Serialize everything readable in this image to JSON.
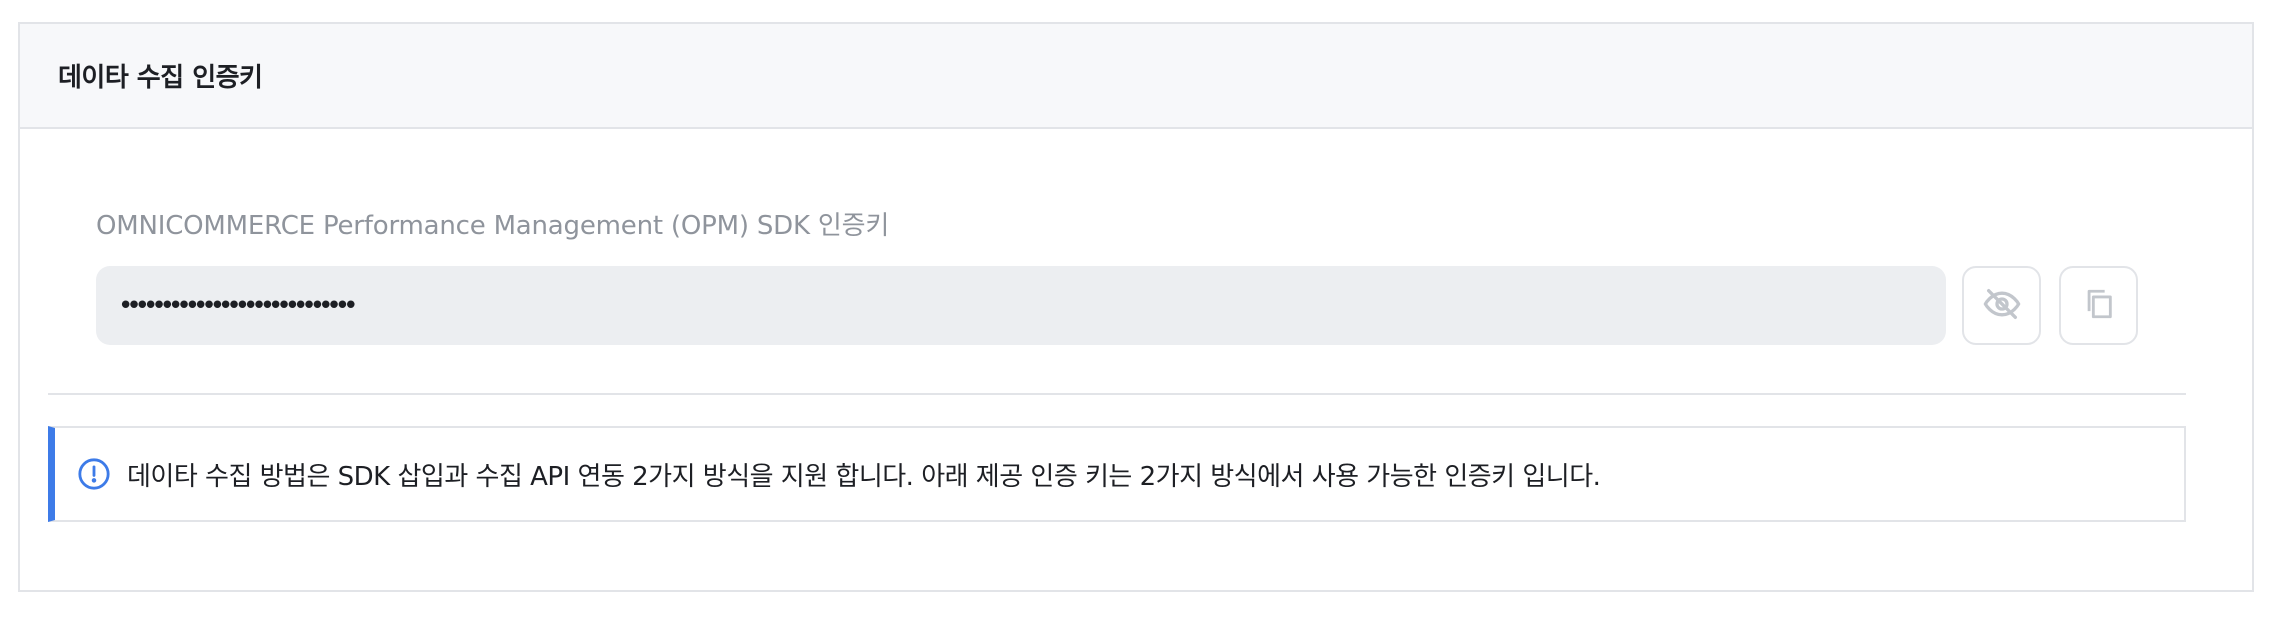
{
  "card": {
    "title": "데이타 수집 인증키"
  },
  "key_field": {
    "label": "OMNICOMMERCE Performance Management (OPM) SDK 인증키",
    "masked_value": "••••••••••••••••••••••••••••",
    "actions": {
      "toggle_visibility_icon": "eye-slash-icon",
      "copy_icon": "copy-icon"
    }
  },
  "notice": {
    "icon": "info-icon",
    "text": "데이타 수집 방법은 SDK 삽입과 수집 API 연동 2가지 방식을 지원 합니다. 아래 제공 인증 키는 2가지 방식에서 사용 가능한 인증키 입니다."
  },
  "colors": {
    "accent": "#3d7be8",
    "border": "#e2e4e8",
    "header_bg": "#f7f8fa",
    "input_bg": "#eceef1",
    "label": "#8f949c",
    "icon_muted": "#c2c6cc"
  }
}
